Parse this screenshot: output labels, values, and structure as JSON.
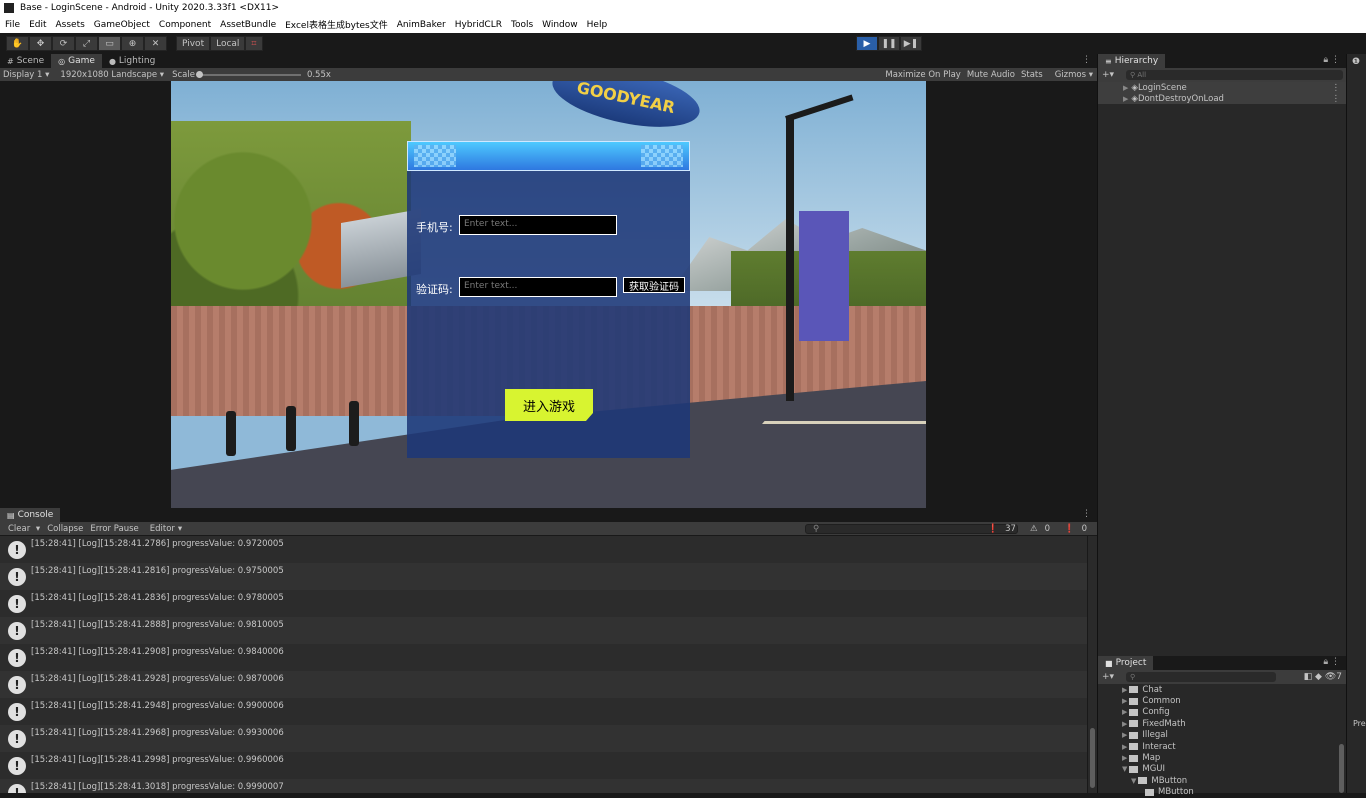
{
  "window": {
    "title": "Base - LoginScene - Android - Unity 2020.3.33f1 <DX11>"
  },
  "menu": [
    "File",
    "Edit",
    "Assets",
    "GameObject",
    "Component",
    "AssetBundle",
    "Excel表格生成bytes文件",
    "AnimBaker",
    "HybridCLR",
    "Tools",
    "Window",
    "Help"
  ],
  "toolbar": {
    "tool_icons": [
      "hand-icon",
      "move-icon",
      "rotate-icon",
      "scale-icon",
      "rect-icon",
      "transform-icon",
      "custom-tool-icon"
    ],
    "pivot_label": "Pivot",
    "local_label": "Local",
    "play_buttons": [
      "play-icon",
      "pause-icon",
      "step-icon"
    ],
    "accent": "#2a5fa8"
  },
  "game_panel": {
    "tabs": [
      {
        "label": "Scene",
        "icon": "grid-icon"
      },
      {
        "label": "Game",
        "icon": "gamepad-icon"
      },
      {
        "label": "Lighting",
        "icon": "bulb-icon"
      }
    ],
    "display": "Display 1",
    "resolution": "1920x1080 Landscape",
    "scale_label": "Scale",
    "scale_value": "0.55x",
    "right_options": [
      "Maximize On Play",
      "Mute Audio",
      "Stats",
      "Gizmos"
    ]
  },
  "login": {
    "blimp_text": "GOODYEAR",
    "phone_label": "手机号:",
    "phone_placeholder": "Enter text...",
    "code_label": "验证码:",
    "code_placeholder": "Enter text...",
    "get_code_button": "获取验证码",
    "enter_button": "进入游戏",
    "accent": "#d8f430"
  },
  "console": {
    "tab_label": "Console",
    "controls": [
      "Clear",
      "Collapse",
      "Error Pause",
      "Editor"
    ],
    "search_placeholder": "",
    "counts": {
      "logs": "37",
      "warnings": "0",
      "errors": "0"
    },
    "logs": [
      "[15:28:41] [Log][15:28:41.2786] progressValue: 0.9720005",
      "[15:28:41] [Log][15:28:41.2816] progressValue: 0.9750005",
      "[15:28:41] [Log][15:28:41.2836] progressValue: 0.9780005",
      "[15:28:41] [Log][15:28:41.2888] progressValue: 0.9810005",
      "[15:28:41] [Log][15:28:41.2908] progressValue: 0.9840006",
      "[15:28:41] [Log][15:28:41.2928] progressValue: 0.9870006",
      "[15:28:41] [Log][15:28:41.2948] progressValue: 0.9900006",
      "[15:28:41] [Log][15:28:41.2968] progressValue: 0.9930006",
      "[15:28:41] [Log][15:28:41.2998] progressValue: 0.9960006",
      "[15:28:41] [Log][15:28:41.3018] progressValue: 0.9990007"
    ]
  },
  "hierarchy": {
    "tab_label": "Hierarchy",
    "search_placeholder": "All",
    "items": [
      "LoginScene",
      "DontDestroyOnLoad"
    ]
  },
  "project": {
    "tab_label": "Project",
    "counter": "7",
    "folders": [
      "Chat",
      "Common",
      "Config",
      "FixedMath",
      "Illegal",
      "Interact",
      "Map",
      "MGUI"
    ],
    "subfolders": [
      "MButton"
    ],
    "subsub": [
      "MButton"
    ]
  },
  "right_strip": {
    "label": "Pre"
  }
}
